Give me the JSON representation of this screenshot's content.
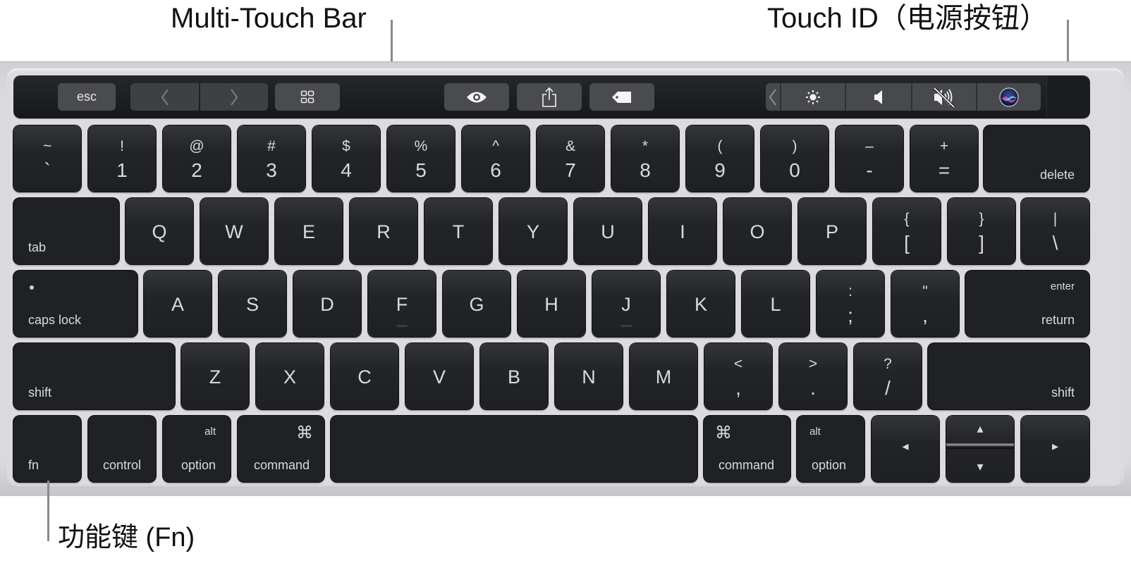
{
  "callouts": {
    "touch_bar": "Multi-Touch Bar",
    "touch_id": "Touch ID（电源按钮）",
    "fn_key": "功能键 (Fn)"
  },
  "touch_bar": {
    "buttons": [
      {
        "name": "esc",
        "label": "esc",
        "icon": null
      },
      {
        "name": "back",
        "label": "‹",
        "icon": "chevron-left-icon"
      },
      {
        "name": "forward",
        "label": "›",
        "icon": "chevron-right-icon"
      },
      {
        "name": "view",
        "label": "",
        "icon": "grid-view-icon"
      },
      {
        "name": "quick-look",
        "label": "",
        "icon": "eye-icon"
      },
      {
        "name": "share",
        "label": "",
        "icon": "share-icon"
      },
      {
        "name": "tags",
        "label": "",
        "icon": "tag-icon"
      }
    ],
    "control_strip": [
      {
        "name": "expand",
        "icon": "chevron-left-icon"
      },
      {
        "name": "brightness",
        "icon": "brightness-icon"
      },
      {
        "name": "volume",
        "icon": "speaker-icon"
      },
      {
        "name": "mute",
        "icon": "speaker-muted-icon"
      },
      {
        "name": "siri",
        "icon": "siri-icon"
      }
    ],
    "touch_id": {
      "name": "touch-id",
      "icon": "touch-id-sensor"
    }
  },
  "rows": [
    [
      {
        "top": "~",
        "bot": "`"
      },
      {
        "top": "!",
        "bot": "1"
      },
      {
        "top": "@",
        "bot": "2"
      },
      {
        "top": "#",
        "bot": "3"
      },
      {
        "top": "$",
        "bot": "4"
      },
      {
        "top": "%",
        "bot": "5"
      },
      {
        "top": "^",
        "bot": "6"
      },
      {
        "top": "&",
        "bot": "7"
      },
      {
        "top": "*",
        "bot": "8"
      },
      {
        "top": "(",
        "bot": "9"
      },
      {
        "top": ")",
        "bot": "0"
      },
      {
        "top": "–",
        "bot": "-"
      },
      {
        "top": "+",
        "bot": "="
      },
      {
        "br": "delete"
      }
    ],
    [
      {
        "bl": "tab"
      },
      {
        "mid": "Q"
      },
      {
        "mid": "W"
      },
      {
        "mid": "E"
      },
      {
        "mid": "R"
      },
      {
        "mid": "T"
      },
      {
        "mid": "Y"
      },
      {
        "mid": "U"
      },
      {
        "mid": "I"
      },
      {
        "mid": "O"
      },
      {
        "mid": "P"
      },
      {
        "top": "{",
        "bot": "["
      },
      {
        "top": "}",
        "bot": "]"
      },
      {
        "top": "|",
        "bot": "\\"
      }
    ],
    [
      {
        "bl": "caps lock",
        "dot": true
      },
      {
        "mid": "A"
      },
      {
        "mid": "S"
      },
      {
        "mid": "D"
      },
      {
        "mid": "F",
        "nub": true
      },
      {
        "mid": "G"
      },
      {
        "mid": "H"
      },
      {
        "mid": "J",
        "nub": true
      },
      {
        "mid": "K"
      },
      {
        "mid": "L"
      },
      {
        "top": ":",
        "bot": ";"
      },
      {
        "top": "\"",
        "bot": ","
      },
      {
        "tr": "enter",
        "br": "return"
      }
    ],
    [
      {
        "bl": "shift"
      },
      {
        "mid": "Z"
      },
      {
        "mid": "X"
      },
      {
        "mid": "C"
      },
      {
        "mid": "V"
      },
      {
        "mid": "B"
      },
      {
        "mid": "N"
      },
      {
        "mid": "M"
      },
      {
        "top": "<",
        "bot": ","
      },
      {
        "top": ">",
        "bot": "."
      },
      {
        "top": "?",
        "bot": "/"
      },
      {
        "br": "shift"
      }
    ],
    [
      {
        "bl": "fn"
      },
      {
        "br": "control"
      },
      {
        "tr": "alt",
        "br": "option"
      },
      {
        "trsym": "⌘",
        "br": "command"
      },
      {
        "space": true
      },
      {
        "tlsym": "⌘",
        "bl": "command"
      },
      {
        "tl": "alt",
        "bl": "option"
      },
      {
        "arrow": "◂"
      },
      {
        "arrow_up": "▴",
        "arrow_down": "▾"
      },
      {
        "arrow": "▸"
      }
    ]
  ]
}
